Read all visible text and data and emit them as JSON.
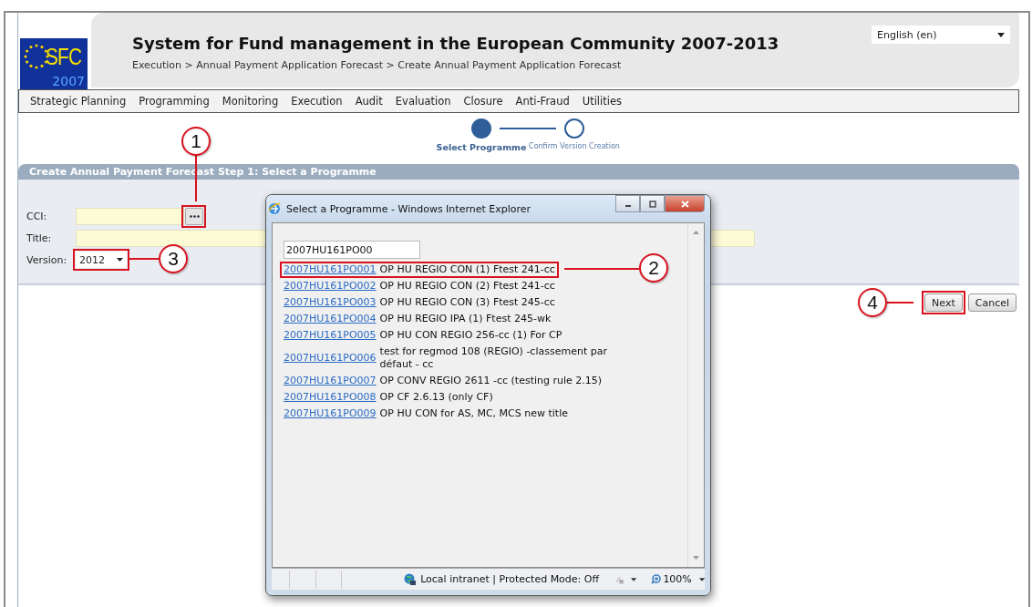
{
  "header": {
    "logo": {
      "acronym": "SFC",
      "year": "2007"
    },
    "title": "System for Fund management in the European Community 2007-2013",
    "breadcrumb": "Execution > Annual Payment Application Forecast > Create Annual Payment Application Forecast",
    "language": "English (en)"
  },
  "menu": [
    "Strategic Planning",
    "Programming",
    "Monitoring",
    "Execution",
    "Audit",
    "Evaluation",
    "Closure",
    "Anti-Fraud",
    "Utilities"
  ],
  "steps": [
    {
      "label": "Select Programme",
      "selected": true
    },
    {
      "label": "Confirm Version Creation",
      "selected": false
    }
  ],
  "section_title": "Create Annual Payment Forecast Step 1: Select a Programme",
  "form": {
    "cci": {
      "label": "CCI:",
      "lookup_highlighted": true
    },
    "title": {
      "label": "Title:"
    },
    "version": {
      "label": "Version:",
      "value": "2012",
      "highlighted": true
    }
  },
  "buttons": [
    {
      "label": "Next",
      "highlighted": true
    },
    {
      "label": "Cancel",
      "highlighted": false
    }
  ],
  "popup": {
    "title": "Select a Programme - Windows Internet Explorer",
    "search_value": "2007HU161PO00",
    "results": [
      {
        "code": "2007HU161PO001",
        "description": "OP HU REGIO CON (1) Ftest 241-cc",
        "highlighted": true
      },
      {
        "code": "2007HU161PO002",
        "description": "OP HU REGIO CON (2) Ftest 241-cc",
        "highlighted": false
      },
      {
        "code": "2007HU161PO003",
        "description": "OP HU REGIO CON (3) Ftest 245-cc",
        "highlighted": false
      },
      {
        "code": "2007HU161PO004",
        "description": "OP HU REGIO IPA (1) Ftest 245-wk",
        "highlighted": false
      },
      {
        "code": "2007HU161PO005",
        "description": "OP HU CON REGIO 256-cc (1) For CP",
        "highlighted": false
      },
      {
        "code": "2007HU161PO006",
        "description": "test for regmod 108 (REGIO) -classement par défaut - cc",
        "highlighted": false
      },
      {
        "code": "2007HU161PO007",
        "description": "OP CONV REGIO 2611 -cc (testing rule 2.15)",
        "highlighted": false
      },
      {
        "code": "2007HU161PO008",
        "description": "OP CF 2.6.13 (only CF)",
        "highlighted": false
      },
      {
        "code": "2007HU161PO009",
        "description": "OP HU CON for AS, MC, MCS new title",
        "highlighted": false
      }
    ],
    "status": "Local intranet | Protected Mode: Off",
    "zoom": "100%"
  },
  "callouts": [
    {
      "label": "1"
    },
    {
      "label": "2"
    },
    {
      "label": "3"
    },
    {
      "label": "4"
    }
  ]
}
